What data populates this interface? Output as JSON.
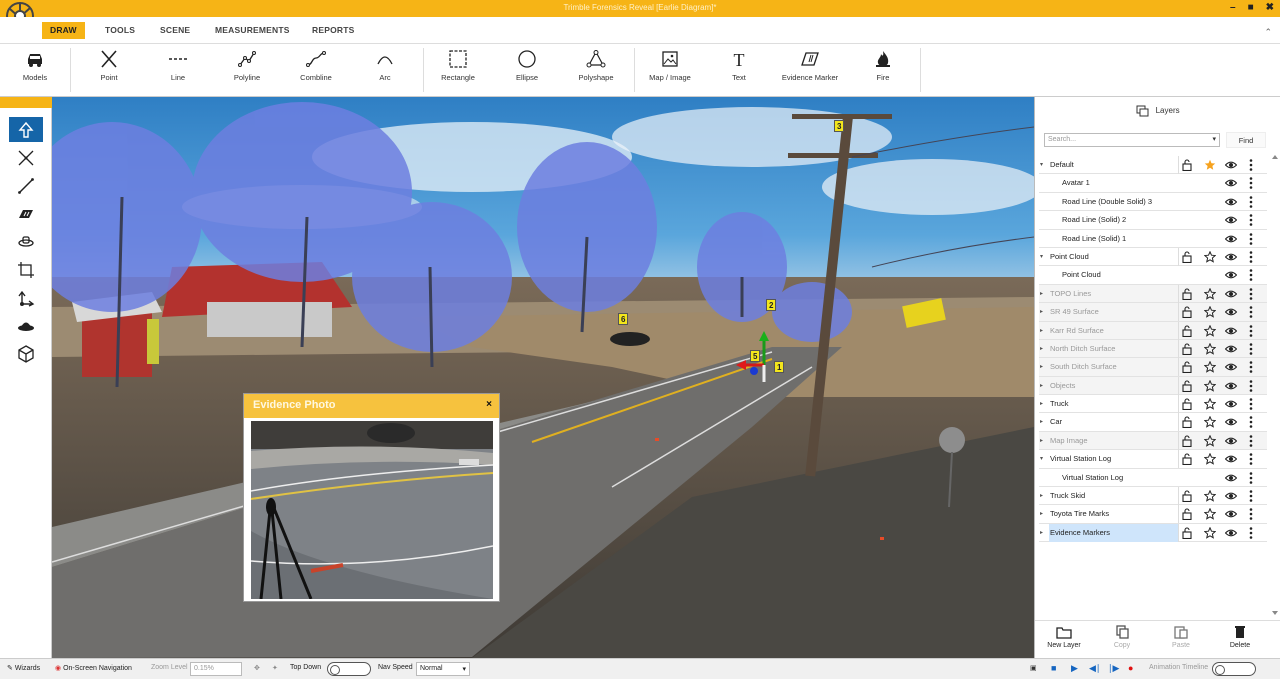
{
  "app": {
    "title": "Trimble Forensics Reveal [Earlie Diagram]*",
    "window_controls": [
      "minimize",
      "maximize",
      "close"
    ]
  },
  "menu": {
    "tabs": [
      "DRAW",
      "TOOLS",
      "SCENE",
      "MEASUREMENTS",
      "REPORTS"
    ],
    "active": "DRAW"
  },
  "toolbar": {
    "tools": [
      {
        "label": "Models",
        "icon": "car-icon"
      },
      {
        "label": "Point",
        "icon": "x-point-icon"
      },
      {
        "label": "Line",
        "icon": "dashed-line-icon"
      },
      {
        "label": "Polyline",
        "icon": "polyline-icon"
      },
      {
        "label": "Combline",
        "icon": "combline-icon"
      },
      {
        "label": "Arc",
        "icon": "arc-icon"
      },
      {
        "label": "Rectangle",
        "icon": "rectangle-icon"
      },
      {
        "label": "Ellipse",
        "icon": "ellipse-icon"
      },
      {
        "label": "Polyshape",
        "icon": "polyshape-icon"
      },
      {
        "label": "Map / Image",
        "icon": "image-icon"
      },
      {
        "label": "Text",
        "icon": "text-icon"
      },
      {
        "label": "Evidence Marker",
        "icon": "evidence-marker-icon"
      },
      {
        "label": "Fire",
        "icon": "fire-icon"
      }
    ]
  },
  "left_tools": [
    "select-arrow-icon",
    "vertex-icon",
    "measure-line-icon",
    "area-icon",
    "orbit-icon",
    "crop-icon",
    "move-axis-icon",
    "saucer-icon",
    "cube-icon"
  ],
  "viewport": {
    "markers": [
      "3",
      "2",
      "6",
      "5",
      "1"
    ],
    "photo_window": {
      "title": "Evidence Photo",
      "close": "×"
    }
  },
  "layers_panel": {
    "title": "Layers",
    "search_placeholder": "Search...",
    "find_label": "Find",
    "rows": [
      {
        "name": "Default",
        "level": 0,
        "expanded": true,
        "dim": false,
        "lock": true,
        "star": "filled"
      },
      {
        "name": "Avatar 1",
        "level": 1
      },
      {
        "name": "Road Line (Double Solid) 3",
        "level": 1
      },
      {
        "name": "Road Line (Solid) 2",
        "level": 1
      },
      {
        "name": "Road Line (Solid) 1",
        "level": 1
      },
      {
        "name": "Point Cloud",
        "level": 0,
        "expanded": true,
        "dim": false,
        "lock": true,
        "star": "empty"
      },
      {
        "name": "Point Cloud",
        "level": 1
      },
      {
        "name": "TOPO Lines",
        "level": 0,
        "dim": true,
        "lock": true,
        "star": "empty"
      },
      {
        "name": "SR 49 Surface",
        "level": 0,
        "dim": true,
        "lock": true,
        "star": "empty"
      },
      {
        "name": "Karr Rd Surface",
        "level": 0,
        "dim": true,
        "lock": true,
        "star": "empty"
      },
      {
        "name": "North Ditch Surface",
        "level": 0,
        "dim": true,
        "lock": true,
        "star": "empty"
      },
      {
        "name": "South Ditch Surface",
        "level": 0,
        "dim": true,
        "lock": true,
        "star": "empty"
      },
      {
        "name": "Objects",
        "level": 0,
        "dim": true,
        "lock": true,
        "star": "empty"
      },
      {
        "name": "Truck",
        "level": 0,
        "dim": false,
        "lock": true,
        "star": "empty"
      },
      {
        "name": "Car",
        "level": 0,
        "dim": false,
        "lock": true,
        "star": "empty"
      },
      {
        "name": "Map Image",
        "level": 0,
        "dim": true,
        "lock": true,
        "star": "empty"
      },
      {
        "name": "Virtual Station Log",
        "level": 0,
        "expanded": true,
        "dim": false,
        "lock": true,
        "star": "empty"
      },
      {
        "name": "Virtual Station Log",
        "level": 1
      },
      {
        "name": "Truck Skid",
        "level": 0,
        "dim": false,
        "lock": true,
        "star": "empty"
      },
      {
        "name": "Toyota Tire Marks",
        "level": 0,
        "dim": false,
        "lock": true,
        "star": "empty"
      },
      {
        "name": "Evidence Markers",
        "level": 0,
        "dim": false,
        "lock": true,
        "star": "empty",
        "selected": true
      }
    ],
    "actions": [
      {
        "label": "New Layer",
        "enabled": true
      },
      {
        "label": "Copy",
        "enabled": false
      },
      {
        "label": "Paste",
        "enabled": false
      },
      {
        "label": "Delete",
        "enabled": true
      }
    ]
  },
  "statusbar": {
    "wizards": "Wizards",
    "onscreen_nav": "On-Screen Navigation",
    "zoom_label": "Zoom Level",
    "zoom_value": "0.15%",
    "top_down": "Top Down",
    "nav_speed_label": "Nav Speed",
    "nav_speed_value": "Normal",
    "animation_timeline": "Animation Timeline"
  },
  "colors": {
    "accent": "#f6b416",
    "selected_tool": "#1565a8",
    "star_filled": "#f6a21e"
  }
}
